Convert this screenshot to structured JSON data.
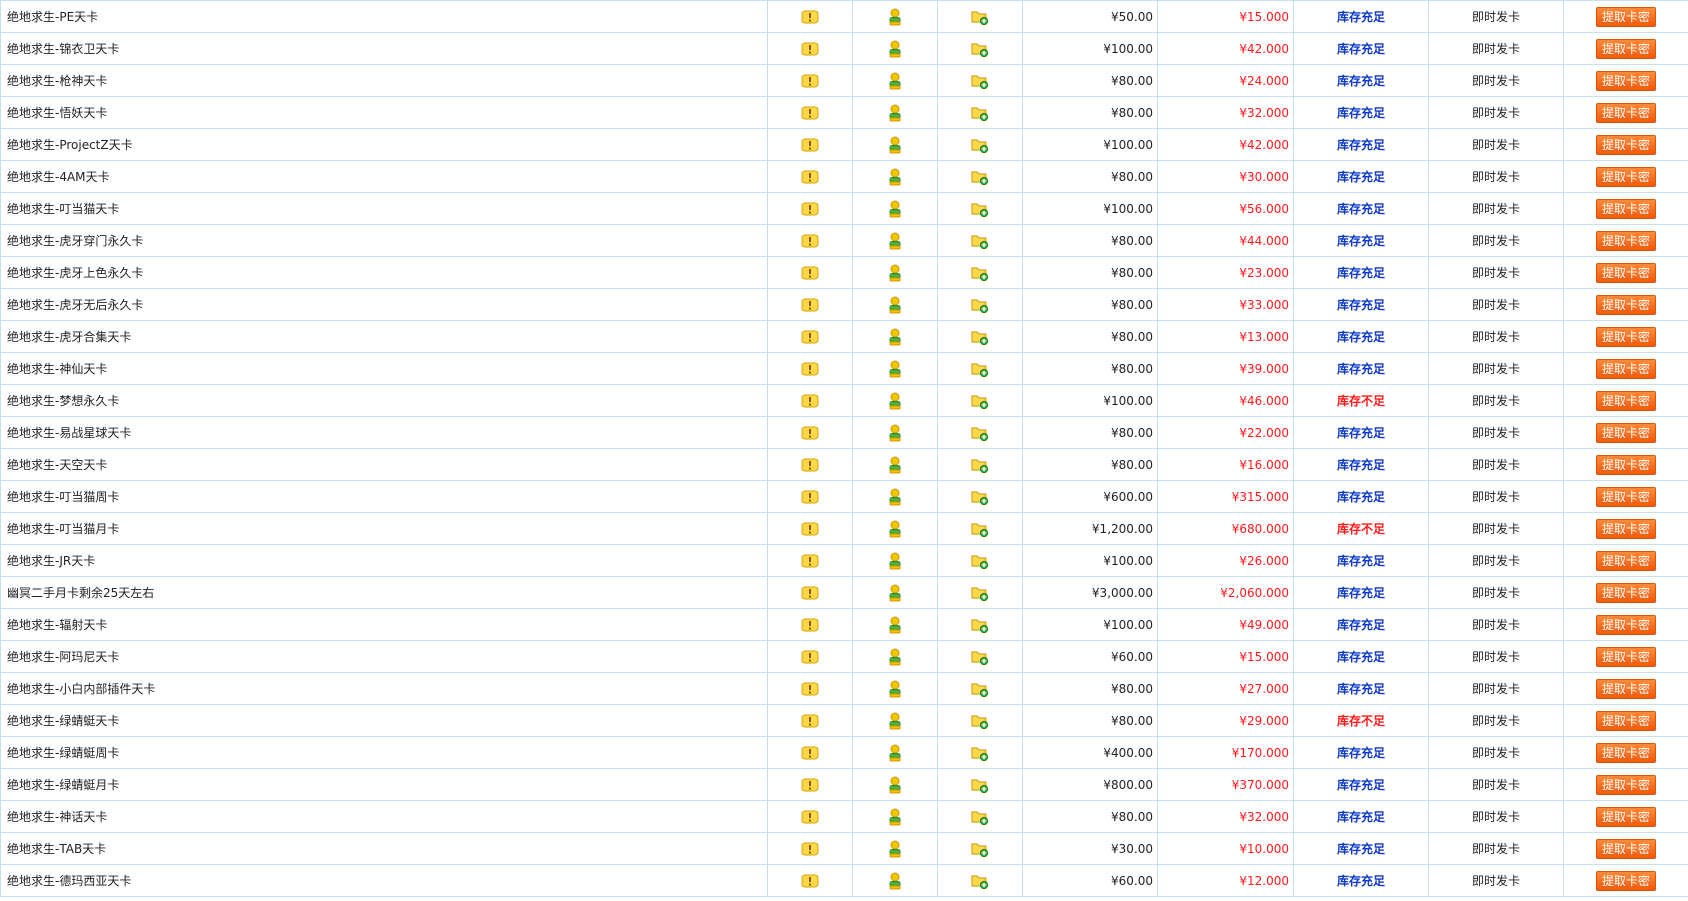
{
  "icons": {
    "info": "info-icon",
    "user": "user-icon",
    "folder_add": "folder-add-icon"
  },
  "colors": {
    "in_stock": "#1038c8",
    "out_of_stock": "#ff1a1a",
    "sale_price": "#ff1a1a",
    "button": "#f26512"
  },
  "rows": [
    {
      "name": "绝地求生-PE天卡",
      "price": "¥50.00",
      "sale": "¥15.000",
      "stock": "库存充足",
      "stock_ok": true,
      "delivery": "即时发卡",
      "action": "提取卡密"
    },
    {
      "name": "绝地求生-锦衣卫天卡",
      "price": "¥100.00",
      "sale": "¥42.000",
      "stock": "库存充足",
      "stock_ok": true,
      "delivery": "即时发卡",
      "action": "提取卡密"
    },
    {
      "name": "绝地求生-枪神天卡",
      "price": "¥80.00",
      "sale": "¥24.000",
      "stock": "库存充足",
      "stock_ok": true,
      "delivery": "即时发卡",
      "action": "提取卡密"
    },
    {
      "name": "绝地求生-悟妖天卡",
      "price": "¥80.00",
      "sale": "¥32.000",
      "stock": "库存充足",
      "stock_ok": true,
      "delivery": "即时发卡",
      "action": "提取卡密"
    },
    {
      "name": "绝地求生-ProjectZ天卡",
      "price": "¥100.00",
      "sale": "¥42.000",
      "stock": "库存充足",
      "stock_ok": true,
      "delivery": "即时发卡",
      "action": "提取卡密"
    },
    {
      "name": "绝地求生-4AM天卡",
      "price": "¥80.00",
      "sale": "¥30.000",
      "stock": "库存充足",
      "stock_ok": true,
      "delivery": "即时发卡",
      "action": "提取卡密"
    },
    {
      "name": "绝地求生-叮当猫天卡",
      "price": "¥100.00",
      "sale": "¥56.000",
      "stock": "库存充足",
      "stock_ok": true,
      "delivery": "即时发卡",
      "action": "提取卡密"
    },
    {
      "name": "绝地求生-虎牙穿门永久卡",
      "price": "¥80.00",
      "sale": "¥44.000",
      "stock": "库存充足",
      "stock_ok": true,
      "delivery": "即时发卡",
      "action": "提取卡密"
    },
    {
      "name": "绝地求生-虎牙上色永久卡",
      "price": "¥80.00",
      "sale": "¥23.000",
      "stock": "库存充足",
      "stock_ok": true,
      "delivery": "即时发卡",
      "action": "提取卡密"
    },
    {
      "name": "绝地求生-虎牙无后永久卡",
      "price": "¥80.00",
      "sale": "¥33.000",
      "stock": "库存充足",
      "stock_ok": true,
      "delivery": "即时发卡",
      "action": "提取卡密"
    },
    {
      "name": "绝地求生-虎牙合集天卡",
      "price": "¥80.00",
      "sale": "¥13.000",
      "stock": "库存充足",
      "stock_ok": true,
      "delivery": "即时发卡",
      "action": "提取卡密"
    },
    {
      "name": "绝地求生-神仙天卡",
      "price": "¥80.00",
      "sale": "¥39.000",
      "stock": "库存充足",
      "stock_ok": true,
      "delivery": "即时发卡",
      "action": "提取卡密"
    },
    {
      "name": "绝地求生-梦想永久卡",
      "price": "¥100.00",
      "sale": "¥46.000",
      "stock": "库存不足",
      "stock_ok": false,
      "delivery": "即时发卡",
      "action": "提取卡密"
    },
    {
      "name": "绝地求生-易战星球天卡",
      "price": "¥80.00",
      "sale": "¥22.000",
      "stock": "库存充足",
      "stock_ok": true,
      "delivery": "即时发卡",
      "action": "提取卡密"
    },
    {
      "name": "绝地求生-天空天卡",
      "price": "¥80.00",
      "sale": "¥16.000",
      "stock": "库存充足",
      "stock_ok": true,
      "delivery": "即时发卡",
      "action": "提取卡密"
    },
    {
      "name": "绝地求生-叮当猫周卡",
      "price": "¥600.00",
      "sale": "¥315.000",
      "stock": "库存充足",
      "stock_ok": true,
      "delivery": "即时发卡",
      "action": "提取卡密"
    },
    {
      "name": "绝地求生-叮当猫月卡",
      "price": "¥1,200.00",
      "sale": "¥680.000",
      "stock": "库存不足",
      "stock_ok": false,
      "delivery": "即时发卡",
      "action": "提取卡密"
    },
    {
      "name": "绝地求生-JR天卡",
      "price": "¥100.00",
      "sale": "¥26.000",
      "stock": "库存充足",
      "stock_ok": true,
      "delivery": "即时发卡",
      "action": "提取卡密"
    },
    {
      "name": "幽冥二手月卡剩余25天左右",
      "price": "¥3,000.00",
      "sale": "¥2,060.000",
      "stock": "库存充足",
      "stock_ok": true,
      "delivery": "即时发卡",
      "action": "提取卡密"
    },
    {
      "name": "绝地求生-辐射天卡",
      "price": "¥100.00",
      "sale": "¥49.000",
      "stock": "库存充足",
      "stock_ok": true,
      "delivery": "即时发卡",
      "action": "提取卡密"
    },
    {
      "name": "绝地求生-阿玛尼天卡",
      "price": "¥60.00",
      "sale": "¥15.000",
      "stock": "库存充足",
      "stock_ok": true,
      "delivery": "即时发卡",
      "action": "提取卡密"
    },
    {
      "name": "绝地求生-小白内部插件天卡",
      "price": "¥80.00",
      "sale": "¥27.000",
      "stock": "库存充足",
      "stock_ok": true,
      "delivery": "即时发卡",
      "action": "提取卡密"
    },
    {
      "name": "绝地求生-绿蜻蜓天卡",
      "price": "¥80.00",
      "sale": "¥29.000",
      "stock": "库存不足",
      "stock_ok": false,
      "delivery": "即时发卡",
      "action": "提取卡密"
    },
    {
      "name": "绝地求生-绿蜻蜓周卡",
      "price": "¥400.00",
      "sale": "¥170.000",
      "stock": "库存充足",
      "stock_ok": true,
      "delivery": "即时发卡",
      "action": "提取卡密"
    },
    {
      "name": "绝地求生-绿蜻蜓月卡",
      "price": "¥800.00",
      "sale": "¥370.000",
      "stock": "库存充足",
      "stock_ok": true,
      "delivery": "即时发卡",
      "action": "提取卡密"
    },
    {
      "name": "绝地求生-神话天卡",
      "price": "¥80.00",
      "sale": "¥32.000",
      "stock": "库存充足",
      "stock_ok": true,
      "delivery": "即时发卡",
      "action": "提取卡密"
    },
    {
      "name": "绝地求生-TAB天卡",
      "price": "¥30.00",
      "sale": "¥10.000",
      "stock": "库存充足",
      "stock_ok": true,
      "delivery": "即时发卡",
      "action": "提取卡密"
    },
    {
      "name": "绝地求生-德玛西亚天卡",
      "price": "¥60.00",
      "sale": "¥12.000",
      "stock": "库存充足",
      "stock_ok": true,
      "delivery": "即时发卡",
      "action": "提取卡密"
    }
  ]
}
